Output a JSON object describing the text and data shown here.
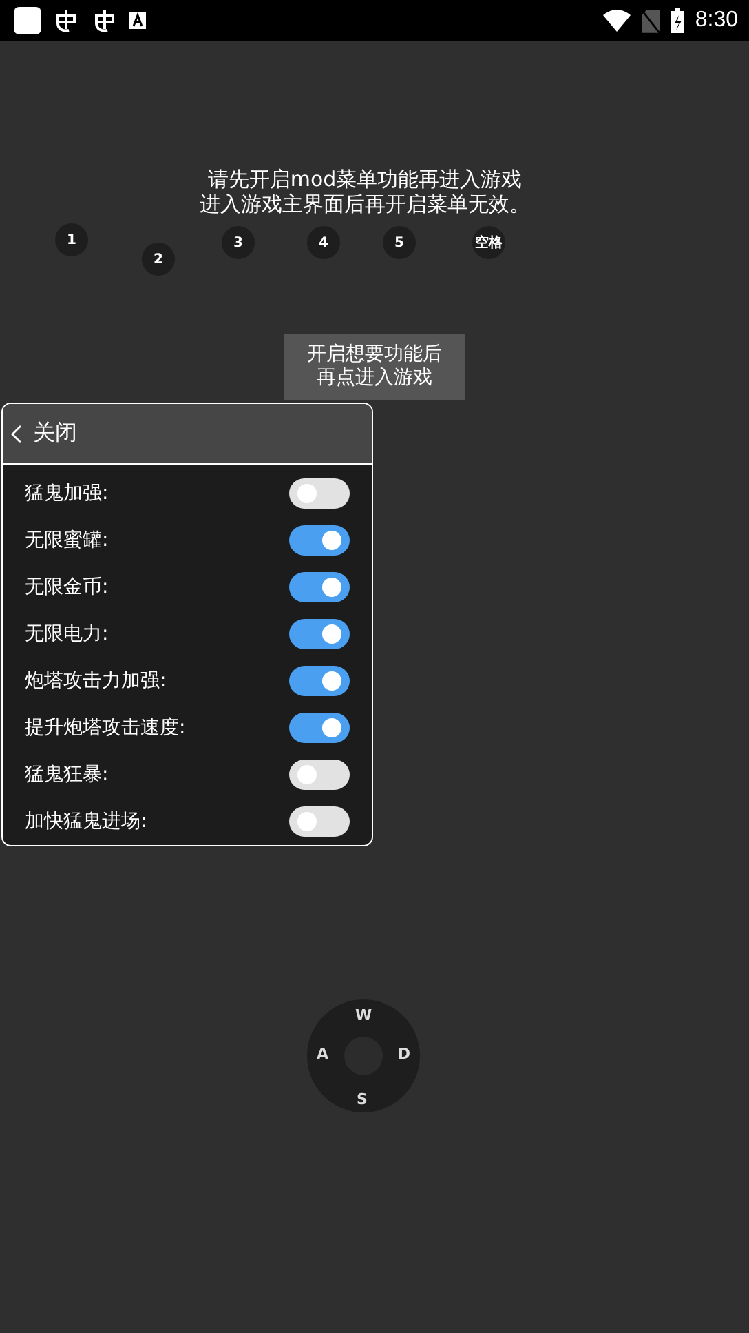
{
  "status_bar": {
    "time": "8:30"
  },
  "keys": [
    {
      "label": "1"
    },
    {
      "label": "2"
    },
    {
      "label": "3"
    },
    {
      "label": "4"
    },
    {
      "label": "5"
    },
    {
      "label": "空格"
    }
  ],
  "notice": [
    "请先开启mod菜单功能再进入游戏",
    "进入游戏主界面后再开启菜单无效。"
  ],
  "toast": [
    "开启想要功能后",
    "再点进入游戏"
  ],
  "menu": {
    "close_label": "关闭",
    "items": [
      {
        "label": "猛鬼加强:",
        "on": false
      },
      {
        "label": "无限蜜罐:",
        "on": true
      },
      {
        "label": "无限金币:",
        "on": true
      },
      {
        "label": "无限电力:",
        "on": true
      },
      {
        "label": "炮塔攻击力加强:",
        "on": true
      },
      {
        "label": "提升炮塔攻击速度:",
        "on": true
      },
      {
        "label": "猛鬼狂暴:",
        "on": false
      },
      {
        "label": "加快猛鬼进场:",
        "on": false
      }
    ]
  },
  "joystick": {
    "up": "W",
    "left": "A",
    "right": "D",
    "down": "S"
  }
}
